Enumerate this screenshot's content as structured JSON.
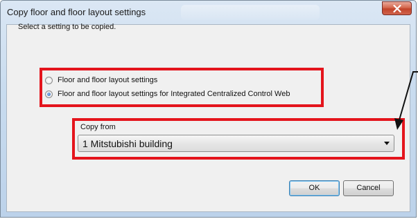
{
  "window": {
    "title": "Copy floor and floor layout settings"
  },
  "dialog": {
    "prompt": "Select a setting to be copied.",
    "options": [
      {
        "label": "Floor and floor layout settings",
        "checked": false
      },
      {
        "label": "Floor and floor layout settings for Integrated Centralized Control Web",
        "checked": true
      }
    ],
    "copy_from_label": "Copy from",
    "copy_from_value": "1  Mitstubishi building",
    "ok_label": "OK",
    "cancel_label": "Cancel"
  },
  "colors": {
    "highlight": "#e4141c",
    "close_button": "#c2432a"
  },
  "icons": {
    "close": "close-icon",
    "dropdown": "chevron-down-icon",
    "annotation": "arrow-icon"
  }
}
